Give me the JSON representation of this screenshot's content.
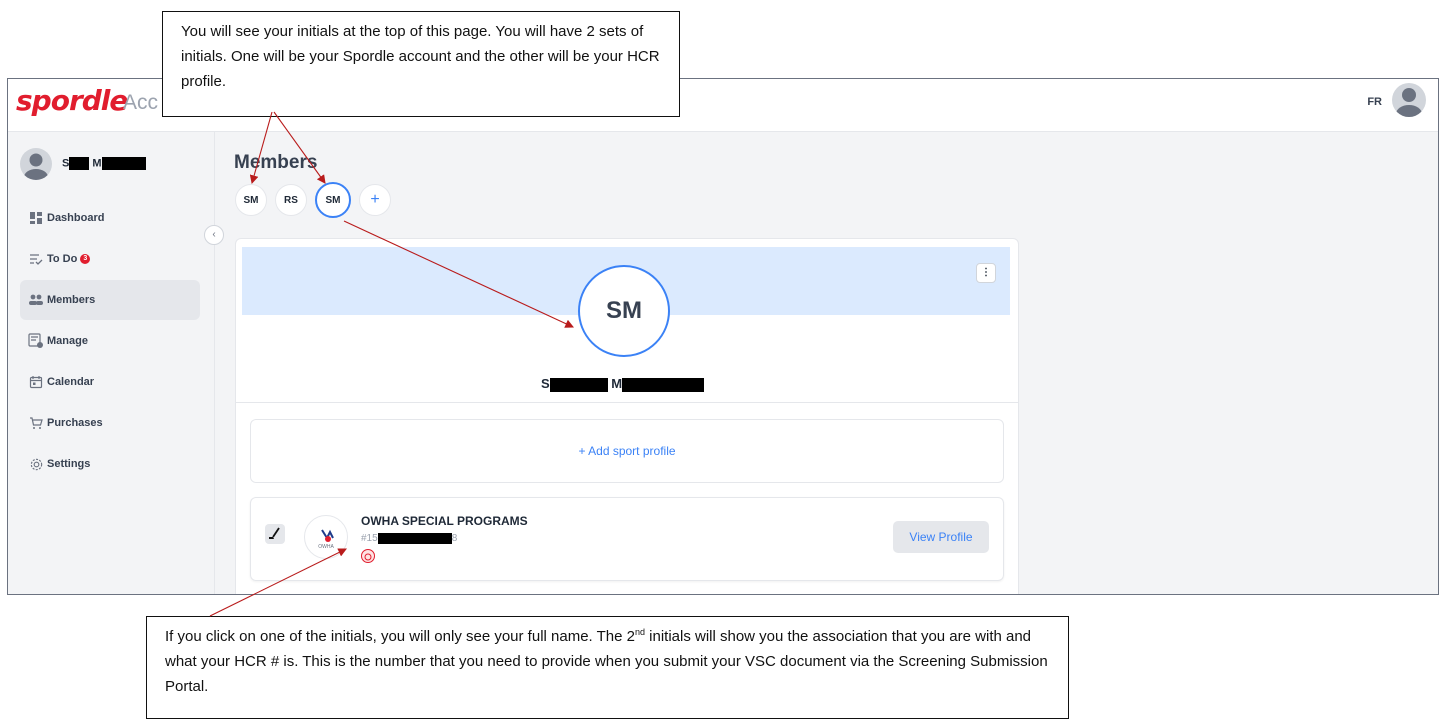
{
  "header": {
    "logo": "spordle",
    "app_subtitle": "Acc",
    "lang": "FR"
  },
  "sidebar": {
    "user_first_initial": "S",
    "user_last_initial": "M",
    "items": [
      {
        "label": "Dashboard",
        "icon": "dashboard-icon"
      },
      {
        "label": "To Do",
        "icon": "todo-icon",
        "badge": "3"
      },
      {
        "label": "Members",
        "icon": "members-icon",
        "active": true
      },
      {
        "label": "Manage",
        "icon": "manage-icon"
      },
      {
        "label": "Calendar",
        "icon": "calendar-icon"
      },
      {
        "label": "Purchases",
        "icon": "cart-icon"
      },
      {
        "label": "Settings",
        "icon": "gear-icon"
      }
    ]
  },
  "main": {
    "title": "Members",
    "member_chips": [
      "SM",
      "RS",
      "SM"
    ],
    "add_chip": "+",
    "card": {
      "kebab": "⋮",
      "avatar_initials": "SM",
      "name_first_initial": "S",
      "name_last_initial": "M",
      "add_sport_profile": "+ Add sport profile",
      "profile": {
        "org_name": "OWHA SPECIAL PROGRAMS",
        "hcr_prefix": "#15",
        "hcr_suffix": "8",
        "view_button": "View Profile",
        "org_logo_text": "OWHA"
      }
    }
  },
  "annotations": {
    "top": "You will see your initials at the top of this page. You will have 2 sets of initials. One will be your Spordle account and the other will be your HCR profile.",
    "bottom_part1": "If you click on one of the initials, you will only see your full name.  The 2",
    "bottom_sup": "nd",
    "bottom_part2": " initials will show you the association that you are with and what your HCR # is.   This is the number that you need to provide when you submit your VSC document via the Screening Submission Portal."
  },
  "colors": {
    "brand": "#e11d2e",
    "accent": "#3b82f6",
    "banner": "#dbeafe",
    "arrow": "#b91c1c"
  }
}
